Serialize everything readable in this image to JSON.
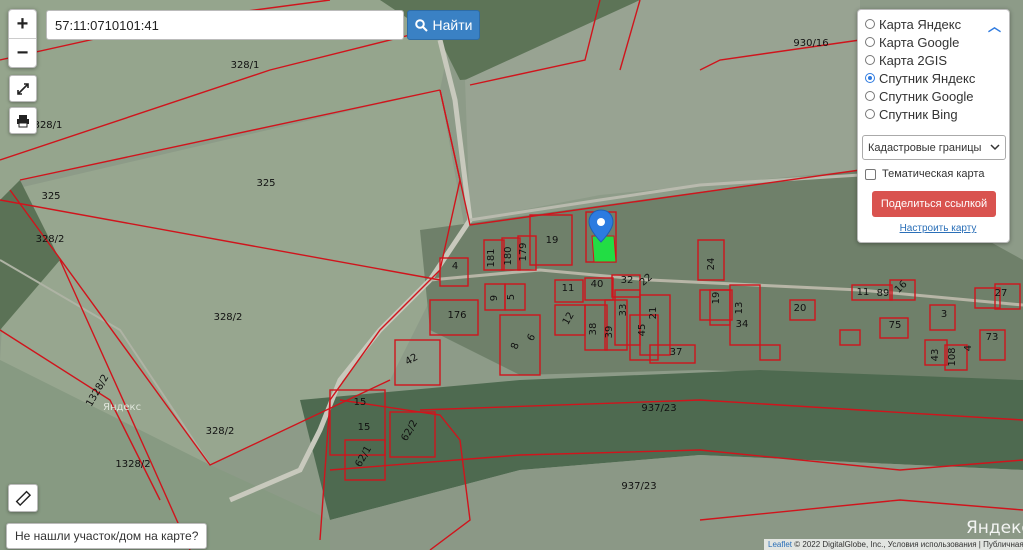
{
  "search": {
    "query": "57:11:0710101:41",
    "button_label": "Найти"
  },
  "zoom": {
    "in_label": "+",
    "out_label": "−"
  },
  "layers": {
    "options": [
      {
        "label": "Карта Яндекс",
        "selected": false
      },
      {
        "label": "Карта Google",
        "selected": false
      },
      {
        "label": "Карта 2GIS",
        "selected": false
      },
      {
        "label": "Спутник Яндекс",
        "selected": true
      },
      {
        "label": "Спутник Google",
        "selected": false
      },
      {
        "label": "Спутник Bing",
        "selected": false
      }
    ],
    "overlay_select": "Кадастровые границы",
    "thematic_label": "Тематическая карта",
    "share_label": "Поделиться ссылкой",
    "setup_label": "Настроить карту"
  },
  "not_found_label": "Не нашли участок/дом на карте?",
  "map": {
    "watermark": "Яндекс",
    "attribution_leaflet": "Leaflet",
    "attribution_text": "© 2022 DigitalGlobe, Inc., Условия использования | Публичная кадастровая карта",
    "yandex_label": "Яндекс",
    "parcel_labels": [
      "930/16",
      "328/1",
      "328/1",
      "325",
      "325",
      "328/2",
      "328/2",
      "328/2",
      "1328/2",
      "1328/2",
      "19",
      "179",
      "180",
      "181",
      "4",
      "9",
      "5",
      "11",
      "40",
      "32",
      "22",
      "176",
      "12",
      "38",
      "39",
      "33",
      "21",
      "24",
      "6",
      "8",
      "42",
      "15",
      "15",
      "62/2",
      "62/1",
      "37",
      "45",
      "19",
      "20",
      "11",
      "89",
      "16",
      "34",
      "13",
      "75",
      "3",
      "27",
      "73",
      "43",
      "108",
      "4",
      "937/23",
      "937/23"
    ]
  },
  "colors": {
    "parcel_border": "#d0141c",
    "selected_parcel": "#22dd44",
    "marker": "#2c7be0",
    "field": "#8f9e8a",
    "forest": "#4e6a50"
  }
}
